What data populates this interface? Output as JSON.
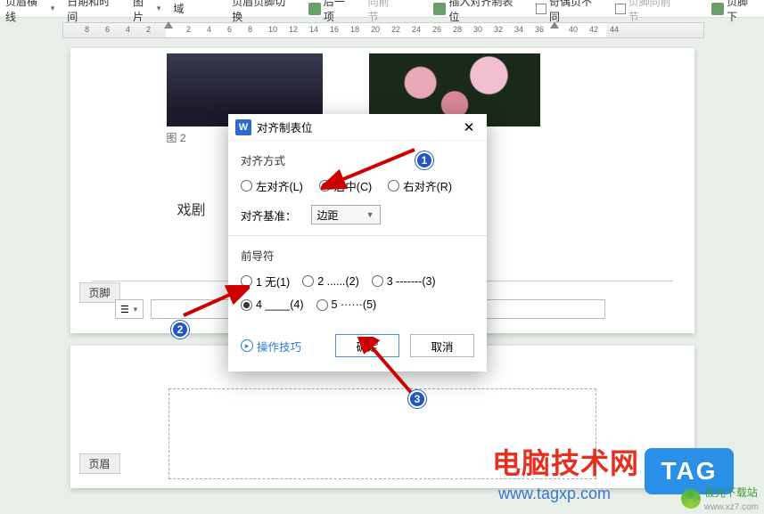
{
  "toolbar": {
    "header_line": "页眉横线",
    "datetime": "日期和时间",
    "picture": "图片",
    "field": "域",
    "header_footer_switch": "页眉页脚切换",
    "prev_section": "后一项",
    "same_prev": "同前节",
    "insert_tab": "插入对齐制表位",
    "odd_even_diff": "奇偶页不同",
    "footer_same_prev": "页脚同前节",
    "footer_bottom": "页脚下"
  },
  "ruler": {
    "nums": [
      "8",
      "6",
      "4",
      "2",
      "2",
      "4",
      "6",
      "8",
      "10",
      "12",
      "14",
      "16",
      "18",
      "20",
      "22",
      "24",
      "26",
      "28",
      "30",
      "32",
      "34",
      "36",
      "40",
      "42",
      "44"
    ]
  },
  "page": {
    "img_caption": "图 2",
    "body_text": "戏剧",
    "footer_label": "页脚",
    "combo_value": "☰",
    "header_label": "页眉"
  },
  "dialog": {
    "title": "对齐制表位",
    "group_align": "对齐方式",
    "align_left": "左对齐(L)",
    "align_center": "居中(C)",
    "align_right": "右对齐(R)",
    "base_label": "对齐基准：",
    "base_value": "边距",
    "group_leader": "前导符",
    "l1": "1 无(1)",
    "l2": "2 ......(2)",
    "l3": "3 -------(3)",
    "l4": "4 ____(4)",
    "l5": "5 ······(5)",
    "tips": "操作技巧",
    "ok": "确定",
    "cancel": "取消"
  },
  "badges": {
    "b1": "1",
    "b2": "2",
    "b3": "3"
  },
  "watermark": {
    "title": "电脑技术网",
    "url": "www.tagxp.com",
    "tag": "TAG",
    "dl_site": "极光下载站",
    "dl_url": "www.xz7.com"
  }
}
